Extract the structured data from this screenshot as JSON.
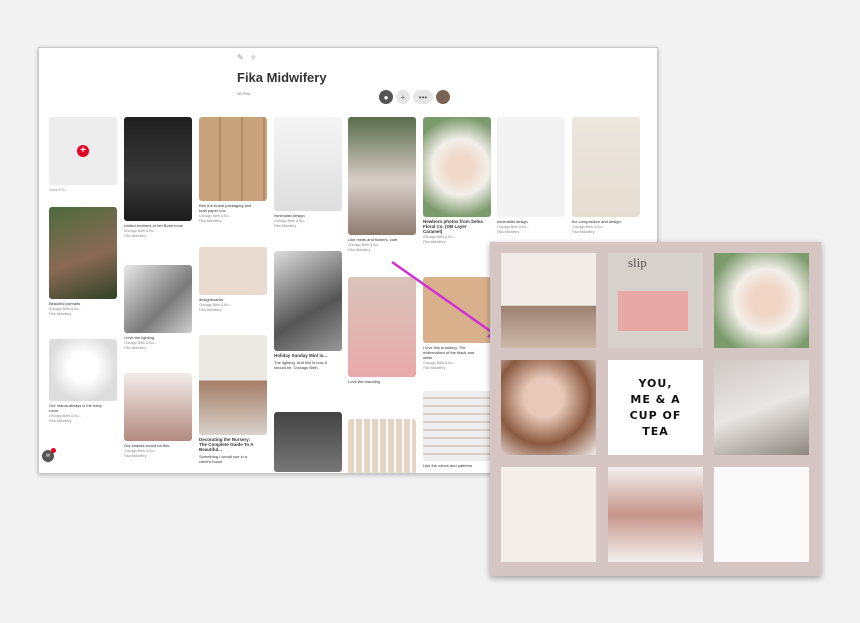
{
  "board": {
    "title": "Fika Midwifery",
    "pin_count": "38 Pins",
    "save_pin_label": "Save Pin"
  },
  "toolbar_icons": [
    "pencil-icon",
    "sparkle-icon"
  ],
  "collaborators": [
    "lock-icon",
    "add-collaborator-icon",
    "collaborator-group-icon",
    "avatar"
  ],
  "pins": [
    {
      "title": "",
      "source": "",
      "board": ""
    },
    {
      "title": "United brothers of fort Bone bone",
      "source": "Chicago Birth & Bo...",
      "board": "Fika Midwifery"
    },
    {
      "title": "Bee the brand packaging and kraft paper box",
      "source": "Chicago Birth & Bo...",
      "board": "Fika Midwifery"
    },
    {
      "title": "minimalist design",
      "source": "Chicago Birth & Bo...",
      "board": "Fika Midwifery"
    },
    {
      "title": "Like mints and flowers, cute",
      "source": "Chicago Birth & Bo...",
      "board": "Fika Midwifery"
    },
    {
      "title": "Newborn photos from Selva Floral Co. (OB Layer Caramel)",
      "source": "Chicago Birth & Bo...",
      "board": "Fika Midwifery"
    },
    {
      "title": "minimalist design",
      "source": "Chicago Birth & Bo...",
      "board": "Fika Midwifery"
    },
    {
      "title": "the composition and design",
      "source": "Chicago Birth & Bo...",
      "board": "Fika Midwifery"
    },
    {
      "title": "Beautiful portraits",
      "source": "Chicago Birth & Bo...",
      "board": "Fika Midwifery"
    },
    {
      "title": "I love the lighting",
      "source": "Chicago Birth & Bo...",
      "board": "Fika Midwifery"
    },
    {
      "title": "designboards",
      "source": "Chicago Birth & Bo...",
      "board": "Fika Midwifery"
    },
    {
      "title": "Holiday Sunday Mint is...",
      "desc": "The lighting. And this is how it should be. Chicago Birth.",
      "source": "Chicago Birth & Bo...",
      "board": "Fika Midwifery"
    },
    {
      "title": "Love the branding",
      "source": "Chicago Birth & Bo...",
      "board": "Fika Midwifery"
    },
    {
      "title": "I love this branding. The maternalism of the black and white",
      "source": "Chicago Birth & Bo...",
      "board": "Fika Midwifery"
    },
    {
      "title": "Our mama always is the baby room",
      "source": "Chicago Birth & Bo...",
      "board": "Fika Midwifery"
    },
    {
      "title": "Our shades would be this.",
      "source": "Chicago Birth & Bo...",
      "board": "Fika Midwifery"
    },
    {
      "title": "Decorating the Nursery: The Complete Guide To A Beautiful...",
      "desc": "Something I would use in a client's home.",
      "source": "Chicago Birth & Bo...",
      "board": "Fika Midwifery"
    },
    {
      "title": "",
      "source": "",
      "board": ""
    },
    {
      "title": "",
      "source": "",
      "board": ""
    },
    {
      "title": "Like the colors and patterns",
      "source": "Chicago Birth & Bo...",
      "board": "Fika Midwifery"
    }
  ],
  "moodboard": {
    "quote": "YOU,\nME & A\nCUP OF\nTEA",
    "slip_text": "slip"
  },
  "colors": {
    "accent": "#e60023",
    "arrow": "#d12fd6",
    "moodboard_bg": "#d6c6c3"
  }
}
